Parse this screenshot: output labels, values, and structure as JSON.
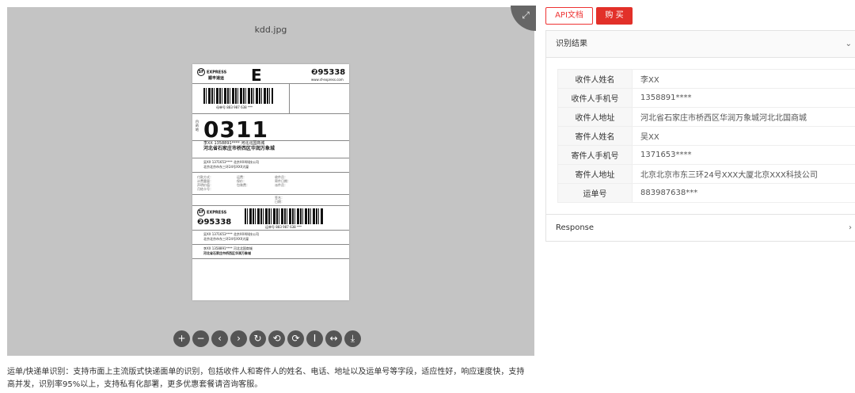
{
  "viewer": {
    "title": "kdd.jpg",
    "fullscreen_icon": "expand-icon",
    "label": {
      "brand_cn": "顺丰速运",
      "brand_en": "EXPRESS",
      "big_letter": "E",
      "hotline": "❷95338",
      "site": "www.sf-express.com",
      "bill_no": "母单号  883 987 638 ***",
      "route_code": "0311",
      "receiver_line1": "李XX  1358891****  河北北国商城",
      "receiver_line2": "河北省石家庄市桥西区华润万象城",
      "sender_line1": "吴XX  1371653****  北京XXX科技公司",
      "sender_line2": "北京北京市东三环24号XXX大厦",
      "bottom_bill_no": "运单号  883 987 638 ***",
      "bottom_sender": "吴XX  1371653****  北京XXX科技公司",
      "bottom_sender2": "北京北京市东三环24号XXX大厦",
      "bottom_receiver": "李XX  1358891****  河北北国商城",
      "bottom_receiver2": "河北省石家庄市桥西区华润万象城"
    },
    "toolbar": [
      {
        "icon": "zoom-in-icon",
        "glyph": "+"
      },
      {
        "icon": "zoom-out-icon",
        "glyph": "−"
      },
      {
        "icon": "prev-icon",
        "glyph": "‹"
      },
      {
        "icon": "next-icon",
        "glyph": "›"
      },
      {
        "icon": "reset-icon",
        "glyph": "↻"
      },
      {
        "icon": "rotate-left-icon",
        "glyph": "⟲"
      },
      {
        "icon": "rotate-right-icon",
        "glyph": "⟳"
      },
      {
        "icon": "fit-height-icon",
        "glyph": "Ⅰ"
      },
      {
        "icon": "fit-width-icon",
        "glyph": "↔"
      },
      {
        "icon": "download-icon",
        "glyph": "⤓"
      }
    ]
  },
  "description_line1": "运单/快递单识别：支持市面上主流版式快递面单的识别，包括收件人和寄件人的姓名、电话、地址以及运单号等字段，适应性好，响应速度快，支持",
  "description_line2": "高并发，识别率95%以上，支持私有化部署，更多优惠套餐请咨询客服。",
  "buttons": {
    "api_doc": "API文档",
    "buy": "购 买"
  },
  "result": {
    "title": "识别结果",
    "rows": [
      {
        "key": "收件人姓名",
        "value": "李XX"
      },
      {
        "key": "收件人手机号",
        "value": "1358891****"
      },
      {
        "key": "收件人地址",
        "value": "河北省石家庄市桥西区华润万象城河北北国商城"
      },
      {
        "key": "寄件人姓名",
        "value": "吴XX"
      },
      {
        "key": "寄件人手机号",
        "value": "1371653****"
      },
      {
        "key": "寄件人地址",
        "value": "北京北京市东三环24号XXX大厦北京XXX科技公司"
      },
      {
        "key": "运单号",
        "value": "883987638***"
      }
    ]
  },
  "response": {
    "title": "Response"
  }
}
